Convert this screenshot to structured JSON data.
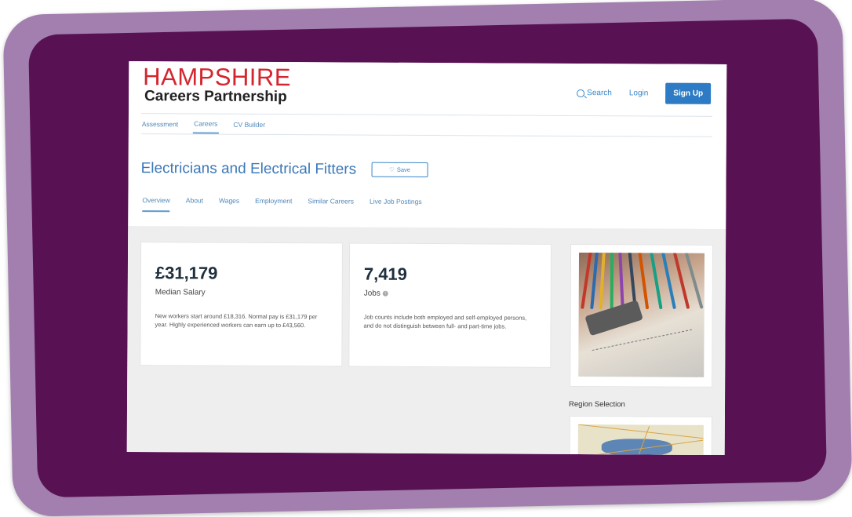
{
  "logo": {
    "line1": "HAMPSHIRE",
    "line2": "Careers Partnership"
  },
  "header": {
    "search_label": "Search",
    "login_label": "Login",
    "signup_label": "Sign Up"
  },
  "subnav": [
    "Assessment",
    "Careers",
    "CV Builder"
  ],
  "page_title": "Electricians and Electrical Fitters",
  "save_label": "Save",
  "tabs": [
    "Overview",
    "About",
    "Wages",
    "Employment",
    "Similar Careers",
    "Live Job Postings"
  ],
  "salary_card": {
    "value": "£31,179",
    "label": "Median Salary",
    "description": "New workers start around £18,316. Normal pay is £31,179 per year. Highly experienced workers can earn up to £43,560."
  },
  "jobs_card": {
    "value": "7,419",
    "label": "Jobs",
    "description": "Job counts include both employed and self-employed persons, and do not distinguish between full- and part-time jobs."
  },
  "region_label": "Region Selection",
  "colors": {
    "brand_red": "#d4262f",
    "accent_blue": "#2d7bc4",
    "frame_outer": "#a27fae",
    "frame_inner": "#581253"
  }
}
